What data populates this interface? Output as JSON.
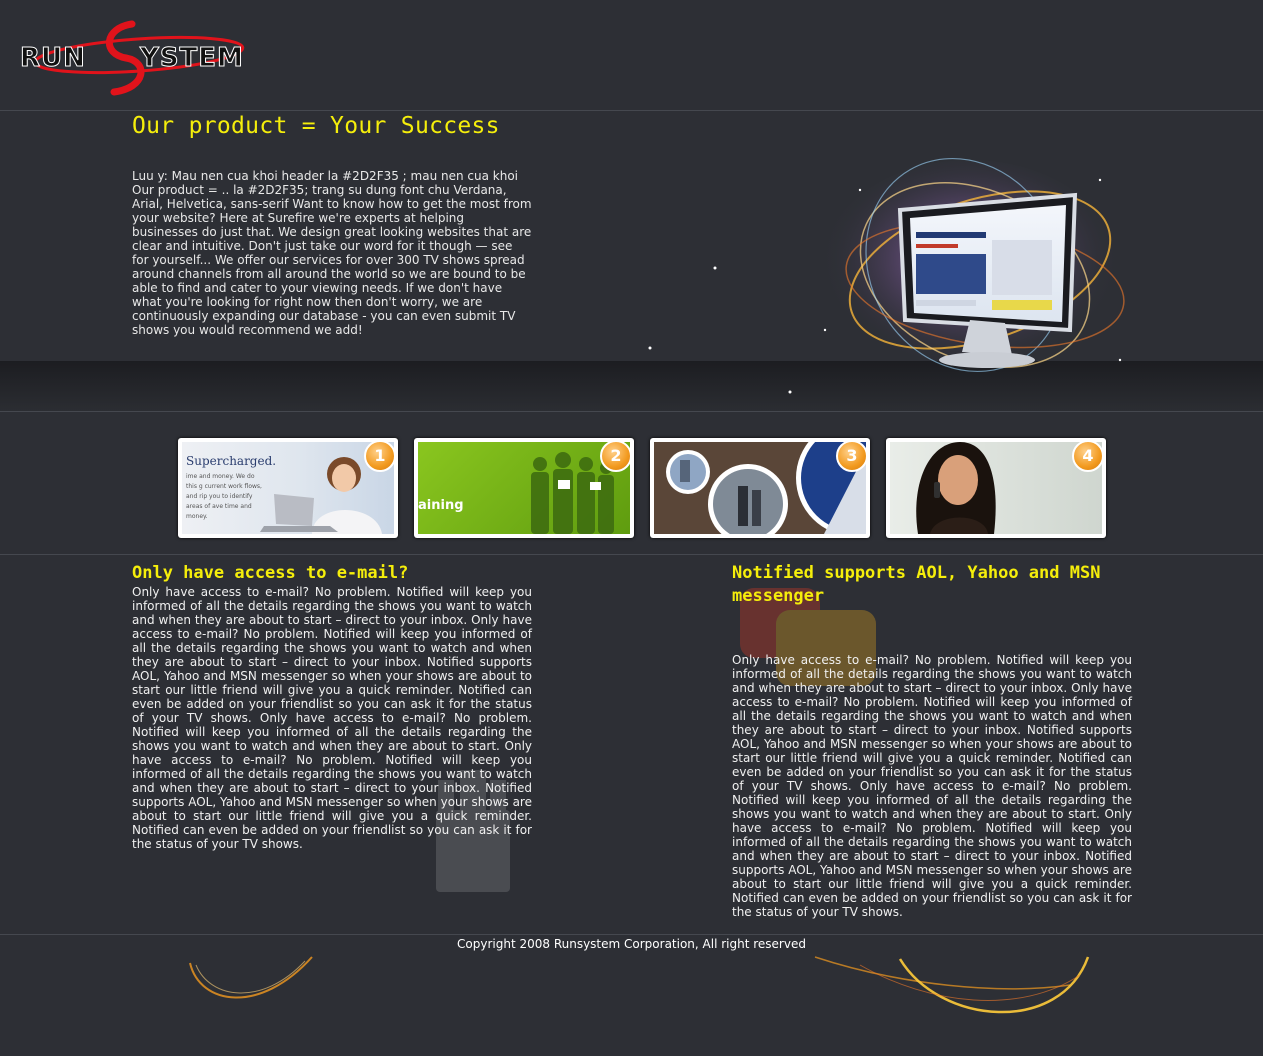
{
  "header": {
    "logo_text": "RUNSYSTEM"
  },
  "hero": {
    "title": "Our product = Your Success",
    "text": "Luu y: Mau nen cua khoi header la #2D2F35 ; mau nen cua khoi Our product = .. la #2D2F35; trang su dung font chu Verdana, Arial, Helvetica, sans-serif Want to know how to get the most from your website? Here at Surefire we're experts at helping businesses do just that. We design great looking websites that are clear and intuitive. Don't just take our word for it though — see for yourself... We offer our services for over 300 TV shows spread around channels from all around the world so we are bound to be able to find and cater to your viewing needs. If we don't have what you're looking for right now then don't worry, we are continuously expanding our database - you can even submit TV shows you would recommend we add!"
  },
  "thumbnails": [
    {
      "number": "1",
      "caption": "Supercharged.",
      "lines": "ime and money. We do this g current work flows, and rip you to identify areas of ave time and money."
    },
    {
      "number": "2",
      "caption": "aining"
    },
    {
      "number": "3"
    },
    {
      "number": "4"
    }
  ],
  "left_column": {
    "title": "Only have access to e-mail?",
    "text": "Only have access to e-mail? No problem. Notified will keep you informed of all the details regarding the shows you want to watch and when they are about to start – direct to your inbox. Only have access to e-mail? No problem. Notified will keep you informed of all the details regarding the shows you want to watch and when they are about to start – direct to your inbox. Notified supports AOL, Yahoo and MSN messenger so when your shows are about to start our little friend will give you a quick reminder. Notified can even be added on your friendlist so you can ask it for the status of your TV shows. Only have access to e-mail? No problem. Notified will keep you informed of all the details regarding the shows you want to watch and when they are about to start. Only have access to e-mail? No problem. Notified will keep you informed of all the details regarding the shows you want to watch and when they are about to start – direct to your inbox. Notified supports AOL, Yahoo and MSN messenger so when your shows are about to start our little friend will give you a quick reminder. Notified can even be added on your friendlist so you can ask it for the status of your TV shows."
  },
  "right_column": {
    "title": "Notified supports AOL, Yahoo and MSN messenger",
    "text": "Only have access to e-mail? No problem. Notified will keep you informed of all the details regarding the shows you want to watch and when they are about to start – direct to your inbox. Only have access to e-mail? No problem. Notified will keep you informed of all the details regarding the shows you want to watch and when they are about to start – direct to your inbox. Notified supports AOL, Yahoo and MSN messenger so when your shows are about to start our little friend will give you a quick reminder. Notified can even be added on your friendlist so you can ask it for the status of your TV shows. Only have access to e-mail? No problem. Notified will keep you informed of all the details regarding the shows you want to watch and when they are about to start. Only have access to e-mail? No problem. Notified will keep you informed of all the details regarding the shows you want to watch and when they are about to start – direct to your inbox. Notified supports AOL, Yahoo and MSN messenger so when your shows are about to start our little friend will give you a quick reminder. Notified can even be added on your friendlist so you can ask it for the status of your TV shows."
  },
  "footer": {
    "copyright": "Copyright 2008 Runsystem Corporation, All right reserved"
  },
  "colors": {
    "background": "#2D2F35",
    "heading": "#F5EE0B",
    "logo_red": "#E1131B",
    "accent_orange": "#F29A1F"
  }
}
